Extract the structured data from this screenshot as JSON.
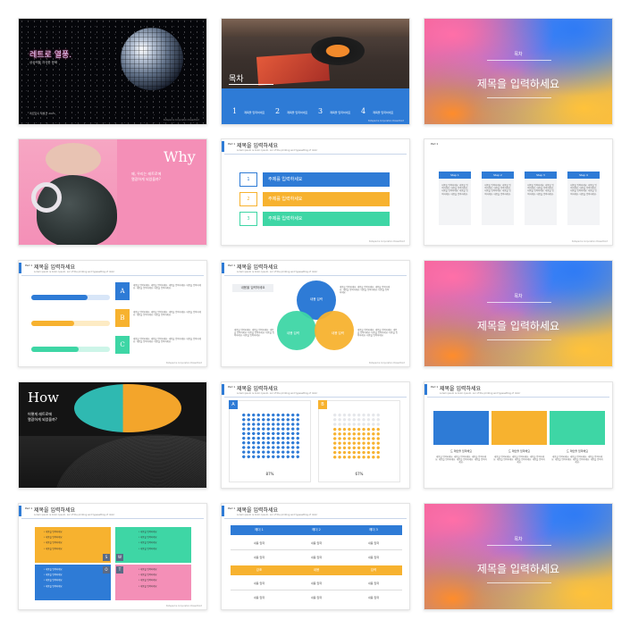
{
  "colors": {
    "blue": "#2e7bd6",
    "orange": "#f7b22f",
    "green": "#3ed6a5",
    "pink": "#f48fb7"
  },
  "common": {
    "slide_title": "제목을 입력하세요",
    "subtitle": "Lorem ipsum is dolor. Ipsum. Lor of the printing and typesetting of dolor",
    "page": "Pad 1",
    "footer": "Slidepad & Corporation PowerPoint",
    "content": "내용을 입력하세요",
    "body": "내용을 입력하세요. 내용을 입력하세요. 내용을 입력하세요. 내용을 입력하세요. 내용을 입력하세요. 내용을 입력하세요."
  },
  "s1": {
    "title": "레트로 열풍.",
    "subtitle": "상상력을 자극한 문화",
    "bottom": "레트로의 재발견 2021",
    "footer": "Slidepad & Corporation PowerPoint"
  },
  "s2": {
    "title": "목차",
    "items": [
      {
        "num": "1",
        "label": "제목을 입력하세요"
      },
      {
        "num": "2",
        "label": "제목을 입력하세요"
      },
      {
        "num": "3",
        "label": "제목을 입력하세요"
      },
      {
        "num": "4",
        "label": "제목을 입력하세요"
      }
    ]
  },
  "s3": {
    "small": "목차",
    "title": "제목을 입력하세요"
  },
  "s4": {
    "title": "Why",
    "sub1": "왜, 우리는 레트로에",
    "sub2": "열광하게 되었을까?"
  },
  "s5": {
    "items": [
      {
        "num": "1",
        "label": "주제를 입력하세요"
      },
      {
        "num": "2",
        "label": "주제를 입력하세요"
      },
      {
        "num": "3",
        "label": "주제를 입력하세요"
      }
    ]
  },
  "s6": {
    "steps": [
      "Step 1",
      "Step 2",
      "Step 3",
      "Step 4"
    ]
  },
  "s7": {
    "letters": [
      "A",
      "B",
      "C"
    ],
    "progress": [
      0.72,
      0.55,
      0.6
    ]
  },
  "s8": {
    "box": "내용을 입력하세요",
    "circles": [
      "내용 입력",
      "내용 입력",
      "내용 입력"
    ]
  },
  "s9": {
    "small": "목차",
    "title": "제목을 입력하세요"
  },
  "s10": {
    "title": "How",
    "sub1": "어떻게 레트로에",
    "sub2": "열광하게 되었을까?"
  },
  "s11": {
    "labels": [
      "A",
      "B"
    ],
    "values": [
      "87%",
      "67%"
    ]
  },
  "s12": {
    "caption": "드 제안을 입력해요"
  },
  "s13": {
    "letters": [
      "S",
      "W",
      "O",
      "T"
    ],
    "bullet": "내용을 입력하세요"
  },
  "s14": {
    "headers": [
      "헤더 1",
      "헤더 2",
      "헤더 3"
    ],
    "mid": [
      "강조",
      "내용",
      "입력"
    ],
    "cell": "내용 입력"
  },
  "s15": {
    "small": "목차",
    "title": "제목을 입력하세요"
  }
}
